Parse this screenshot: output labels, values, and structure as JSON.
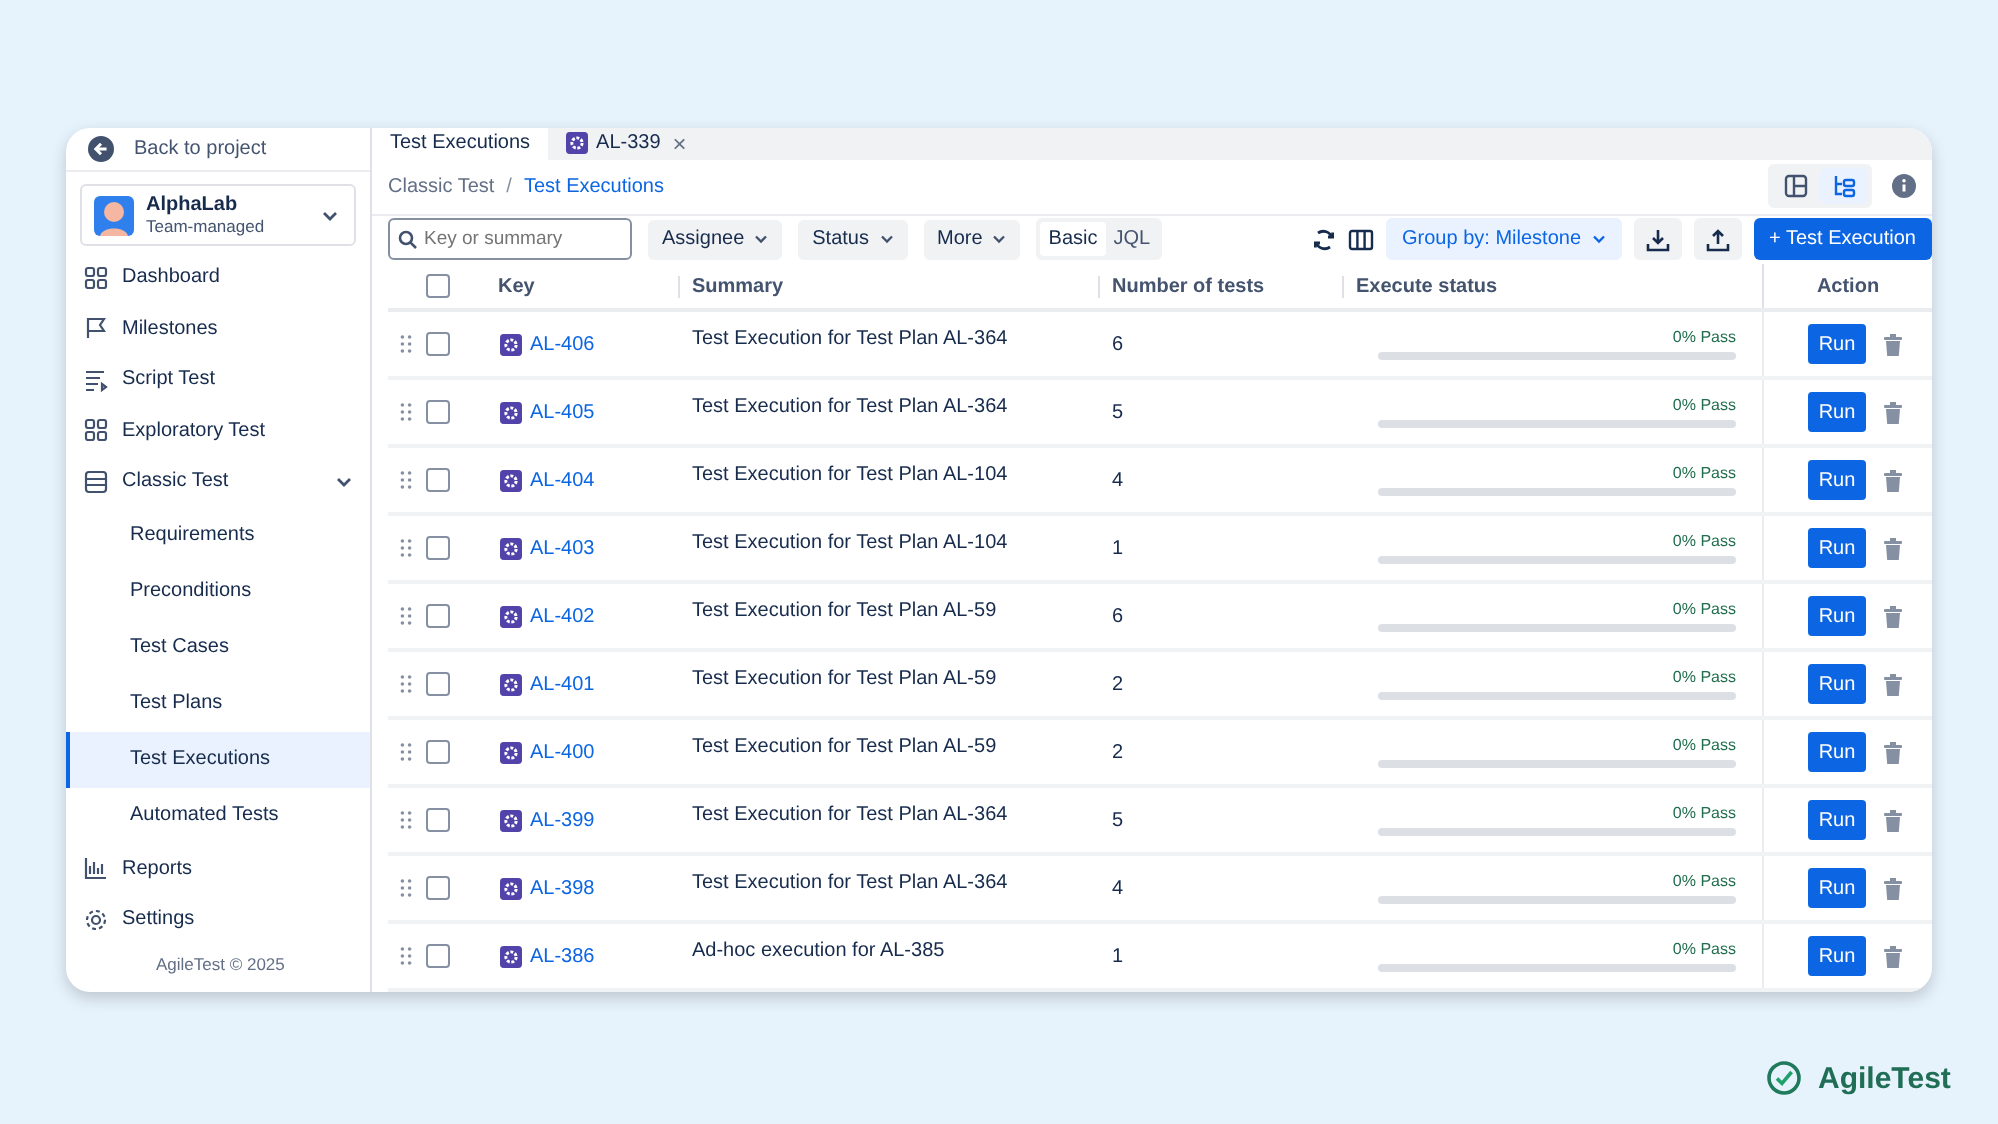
{
  "sidebar": {
    "back": "Back to project",
    "project": {
      "name": "AlphaLab",
      "type": "Team-managed"
    },
    "items": [
      {
        "label": "Dashboard",
        "selected": false
      },
      {
        "label": "Milestones",
        "selected": false
      },
      {
        "label": "Script Test",
        "selected": false
      },
      {
        "label": "Exploratory Test",
        "selected": false
      },
      {
        "label": "Classic Test",
        "selected": false,
        "expanded": true,
        "children": [
          {
            "label": "Requirements",
            "selected": false
          },
          {
            "label": "Preconditions",
            "selected": false
          },
          {
            "label": "Test Cases",
            "selected": false
          },
          {
            "label": "Test Plans",
            "selected": false
          },
          {
            "label": "Test Executions",
            "selected": true
          },
          {
            "label": "Automated Tests",
            "selected": false
          }
        ]
      },
      {
        "label": "Reports",
        "selected": false
      },
      {
        "label": "Settings",
        "selected": false
      }
    ],
    "footer": "AgileTest © 2025"
  },
  "tabs": [
    {
      "label": "Test Executions",
      "selected": true
    },
    {
      "label": "AL-339",
      "selected": false,
      "close": "×"
    }
  ],
  "breadcrumb": {
    "items": [
      "Classic Test",
      "Test Executions"
    ],
    "separator": "/"
  },
  "views": [
    {
      "selected": false
    },
    {
      "selected": true
    }
  ],
  "toolbar": {
    "search": {
      "placeholder": "Key or summary"
    },
    "filters": [
      "Assignee",
      "Status",
      "More"
    ],
    "modes": [
      {
        "label": "Basic",
        "selected": true
      },
      {
        "label": "JQL",
        "selected": false
      }
    ],
    "group_by": "Group by: Milestone",
    "create": "+ Test Execution"
  },
  "table": {
    "select_all_checked": false,
    "columns": [
      "Key",
      "Summary",
      "Number of tests",
      "Execute status",
      "Action"
    ],
    "rows": [
      {
        "checked": false,
        "key": "AL-406",
        "summary": "Test Execution for Test Plan AL-364",
        "tests": "6",
        "status": "0% Pass",
        "level": 0,
        "action": "Run"
      },
      {
        "checked": false,
        "key": "AL-405",
        "summary": "Test Execution for Test Plan AL-364",
        "tests": "5",
        "status": "0% Pass",
        "level": 0,
        "action": "Run"
      },
      {
        "checked": false,
        "key": "AL-404",
        "summary": "Test Execution for Test Plan AL-104",
        "tests": "4",
        "status": "0% Pass",
        "level": 0,
        "action": "Run"
      },
      {
        "checked": false,
        "key": "AL-403",
        "summary": "Test Execution for Test Plan AL-104",
        "tests": "1",
        "status": "0% Pass",
        "level": 0,
        "action": "Run"
      },
      {
        "checked": false,
        "key": "AL-402",
        "summary": "Test Execution for Test Plan AL-59",
        "tests": "6",
        "status": "0% Pass",
        "level": 0,
        "action": "Run"
      },
      {
        "checked": false,
        "key": "AL-401",
        "summary": "Test Execution for Test Plan AL-59",
        "tests": "2",
        "status": "0% Pass",
        "level": 0,
        "action": "Run"
      },
      {
        "checked": false,
        "key": "AL-400",
        "summary": "Test Execution for Test Plan AL-59",
        "tests": "2",
        "status": "0% Pass",
        "level": 0,
        "action": "Run"
      },
      {
        "checked": false,
        "key": "AL-399",
        "summary": "Test Execution for Test Plan AL-364",
        "tests": "5",
        "status": "0% Pass",
        "level": 0,
        "action": "Run"
      },
      {
        "checked": false,
        "key": "AL-398",
        "summary": "Test Execution for Test Plan AL-364",
        "tests": "4",
        "status": "0% Pass",
        "level": 0,
        "action": "Run"
      },
      {
        "checked": false,
        "key": "AL-386",
        "summary": "Ad-hoc execution for AL-385",
        "tests": "1",
        "status": "0% Pass",
        "level": 0,
        "action": "Run"
      }
    ]
  },
  "brand": "AgileTest"
}
